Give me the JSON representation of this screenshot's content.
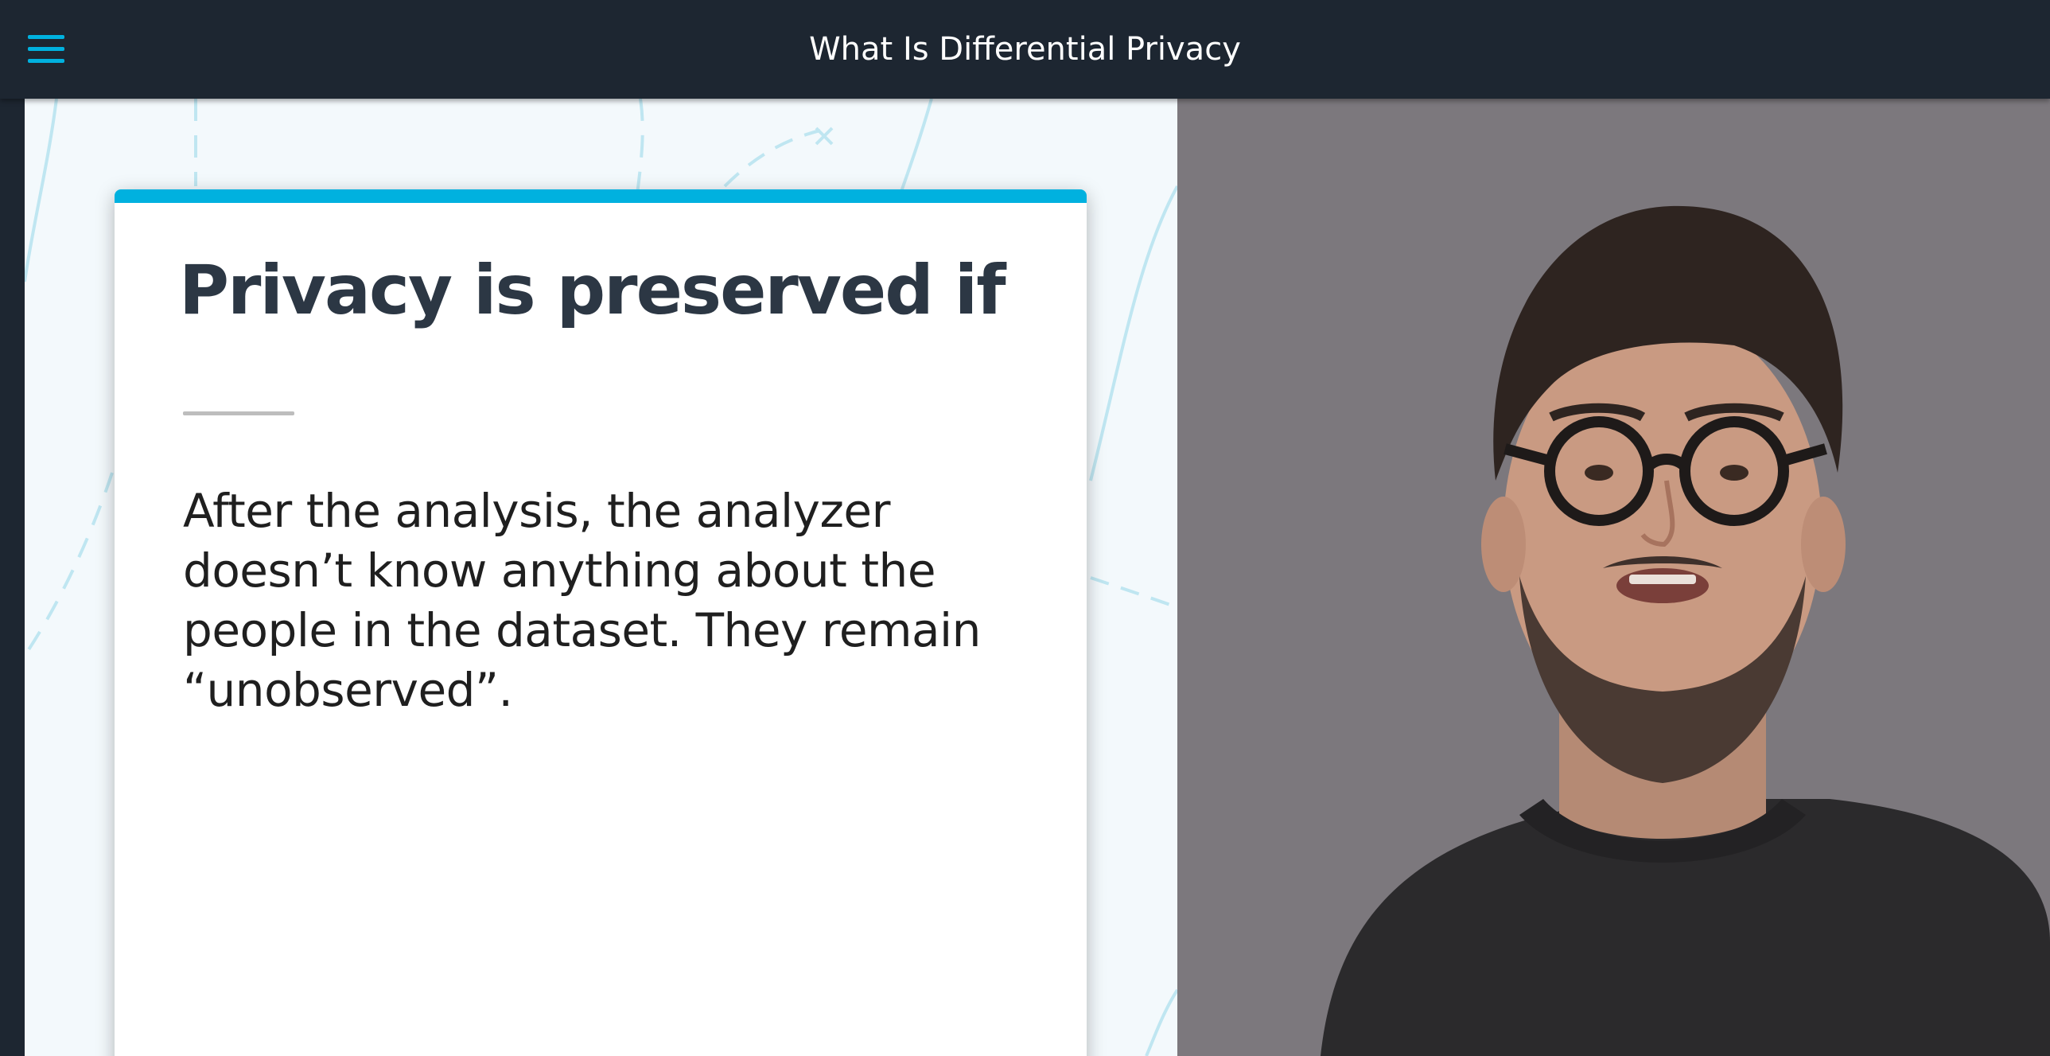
{
  "header": {
    "title": "What Is Differential Privacy",
    "menu_icon": "hamburger-menu-icon"
  },
  "slide": {
    "heading": "Privacy is preserved if",
    "body": "After the analysis, the analyzer doesn’t know anything about the people in the dataset. They remain “unobserved”.",
    "accent_color": "#00b1df"
  },
  "colors": {
    "header_bg": "#1d2631",
    "accent": "#00b1df",
    "heading_text": "#2c3744"
  }
}
